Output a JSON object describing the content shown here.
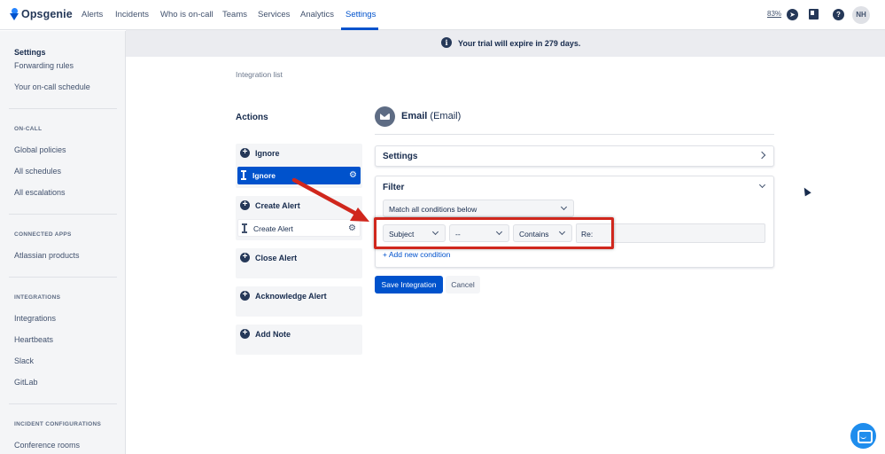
{
  "app": {
    "brand": "Opsgenie",
    "nav": [
      "Alerts",
      "Incidents",
      "Who is on-call",
      "Teams",
      "Services",
      "Analytics",
      "Settings"
    ],
    "active_nav": "Settings",
    "zoom": "83%",
    "avatar_initials": "NH",
    "icons": [
      "compass-icon",
      "book-icon",
      "help-icon"
    ]
  },
  "banner": {
    "text": "Your trial will expire in 279 days."
  },
  "sidebar": {
    "title": "Settings",
    "top_items": [
      "Forwarding rules",
      "Your on-call schedule"
    ],
    "sections": [
      {
        "heading": "ON-CALL",
        "items": [
          "Global policies",
          "All schedules",
          "All escalations"
        ]
      },
      {
        "heading": "CONNECTED APPS",
        "items": [
          "Atlassian products"
        ]
      },
      {
        "heading": "INTEGRATIONS",
        "items": [
          "Integrations",
          "Heartbeats",
          "Slack",
          "GitLab"
        ]
      },
      {
        "heading": "INCIDENT CONFIGURATIONS",
        "items": [
          "Conference rooms"
        ]
      }
    ]
  },
  "main": {
    "breadcrumb": "Integration list",
    "actions_title": "Actions",
    "actions": [
      {
        "label": "Ignore",
        "rules": [
          {
            "label": "Ignore",
            "selected": true
          }
        ]
      },
      {
        "label": "Create Alert",
        "rules": [
          {
            "label": "Create Alert",
            "selected": false
          }
        ]
      },
      {
        "label": "Close Alert",
        "rules": []
      },
      {
        "label": "Acknowledge Alert",
        "rules": []
      },
      {
        "label": "Add Note",
        "rules": []
      }
    ],
    "integration": {
      "name": "Email",
      "type": "(Email)"
    },
    "settings_title": "Settings",
    "filter": {
      "title": "Filter",
      "match_mode": "Match all conditions below",
      "condition": {
        "field": "Subject",
        "not": "--",
        "operation": "Contains",
        "value": "Re:"
      },
      "add_condition": "+ Add new condition"
    },
    "save_label": "Save Integration",
    "cancel_label": "Cancel"
  },
  "annotation": {
    "color": "#d0271d"
  },
  "colors": {
    "primary": "#0052cc",
    "sidebar_bg": "#f4f5f7",
    "banner_bg": "#ebecf0"
  }
}
